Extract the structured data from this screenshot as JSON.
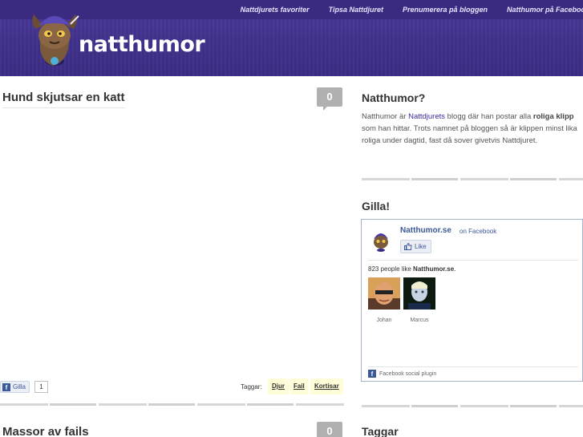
{
  "header": {
    "brand": "natthumor",
    "nav": [
      "Nattdjurets favoriter",
      "Tipsa Nattdjuret",
      "Prenumerera på bloggen",
      "Natthumor på Facebook"
    ]
  },
  "posts": [
    {
      "title": "Hund skjutsar en katt",
      "comments": "0",
      "like_label": "Gilla",
      "like_count": "1",
      "tags_label": "Taggar:",
      "tags": [
        "Djur",
        "Fail",
        "Kortisar"
      ]
    },
    {
      "title": "Massor av fails",
      "comments": "0"
    }
  ],
  "sidebar": {
    "about": {
      "title": "Natthumor?",
      "text_1": "Natthumor är ",
      "link": "Nattdjurets",
      "text_2": " blogg där han postar alla ",
      "bold": "roliga klipp",
      "text_3": " som han hittar. Trots namnet på bloggen så är klippen minst lika roliga under dagtid, fast då sover givetvis Nattdjuret."
    },
    "like": {
      "title": "Gilla!",
      "page_name": "Natthumor.se",
      "on_facebook": "on Facebook",
      "like_button": "Like",
      "count_text": "823 people like ",
      "count_page": "Natthumor.se",
      "count_end": ".",
      "fans": [
        "Johan",
        "Marcus"
      ],
      "plugin_label": "Facebook social plugin"
    },
    "tags_title": "Taggar"
  },
  "colors": {
    "header": "#3e2f88",
    "facebook": "#3b5998",
    "link": "#3a2b9a"
  },
  "icons": [
    "logo-mascot-icon",
    "facebook-icon",
    "thumbs-up-icon",
    "avatar-image"
  ]
}
